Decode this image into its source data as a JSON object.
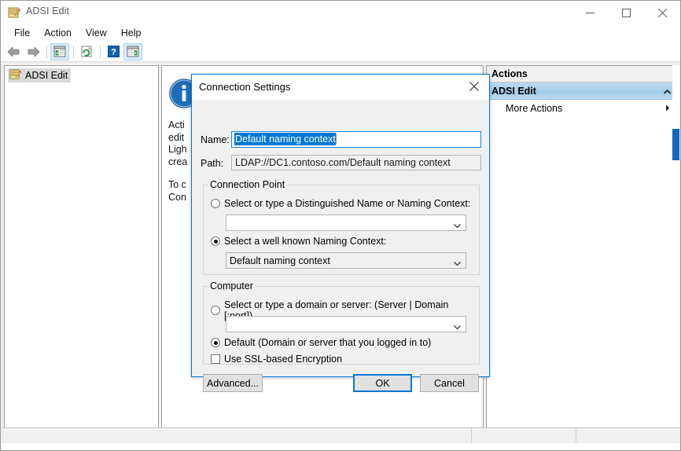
{
  "window": {
    "title": "ADSI Edit",
    "icon": "adsi-edit-icon",
    "minimize_label": "Minimize",
    "maximize_label": "Maximize",
    "close_label": "Close"
  },
  "menubar": {
    "items": [
      {
        "label": "File"
      },
      {
        "label": "Action"
      },
      {
        "label": "View"
      },
      {
        "label": "Help"
      }
    ]
  },
  "toolbar": {
    "buttons": [
      {
        "name": "back-icon",
        "tooltip": "Back"
      },
      {
        "name": "forward-icon",
        "tooltip": "Forward"
      },
      {
        "name": "show-tree-icon",
        "tooltip": "Show/Hide Console Tree",
        "active": true
      },
      {
        "name": "refresh-icon",
        "tooltip": "Refresh"
      },
      {
        "name": "help-icon",
        "tooltip": "Help"
      },
      {
        "name": "show-actions-icon",
        "tooltip": "Show/Hide Action Pane",
        "active": true
      }
    ]
  },
  "tree": {
    "items": [
      {
        "label": "ADSI Edit",
        "icon": "adsi-edit-icon",
        "selected": true
      }
    ]
  },
  "middle_pane": {
    "icon": "info-icon",
    "paragraphs": [
      "Acti\nedit\nLigh\ncrea",
      "To c\nCon"
    ]
  },
  "actions_pane": {
    "header": "Actions",
    "group_title": "ADSI Edit",
    "collapse_icon": "chevron-up-icon",
    "rows": [
      {
        "label": "More Actions",
        "submenu_icon": "chevron-right-icon"
      }
    ]
  },
  "statusbar": {
    "cells": [
      "",
      "",
      ""
    ]
  },
  "dialog": {
    "title": "Connection Settings",
    "close_icon": "close-icon",
    "name_label": "Name:",
    "name_value": "Default naming context",
    "path_label": "Path:",
    "path_value": "LDAP://DC1.contoso.com/Default naming context",
    "connection_point": {
      "legend": "Connection Point",
      "radio_dn_label": "Select or type a Distinguished Name or Naming Context:",
      "radio_dn_selected": false,
      "dn_combo_value": "",
      "radio_wellknown_label": "Select a well known Naming Context:",
      "radio_wellknown_selected": true,
      "wellknown_combo_value": "Default naming context",
      "combo_arrow_icon": "chevron-down-icon"
    },
    "computer": {
      "legend": "Computer",
      "radio_server_label": "Select or type a domain or server: (Server | Domain [:port])",
      "radio_server_selected": false,
      "server_combo_value": "",
      "radio_default_label": "Default (Domain or server that you logged in to)",
      "radio_default_selected": true,
      "ssl_checkbox_label": "Use SSL-based Encryption",
      "ssl_checked": false
    },
    "buttons": {
      "advanced": "Advanced...",
      "ok": "OK",
      "cancel": "Cancel"
    }
  },
  "colors": {
    "accent": "#0078d7",
    "selection": "#0078d7",
    "actions_group": "#a9cfeb",
    "window_bg": "#f0f0f0"
  }
}
